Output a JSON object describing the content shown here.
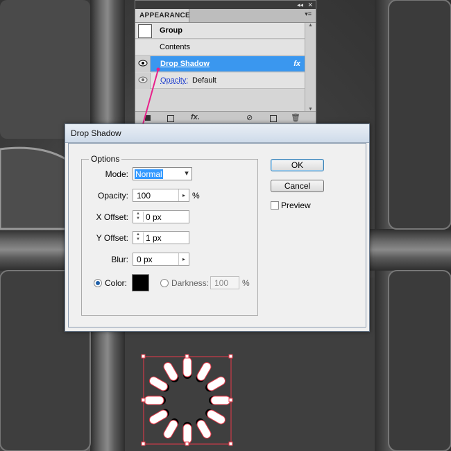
{
  "appearance_panel": {
    "tab_label": "APPEARANCE",
    "collapse_glyph": "◂◂",
    "close_glyph": "✕",
    "menu_glyph": "▾≡",
    "rows": [
      {
        "label": "Group"
      },
      {
        "label": "Contents"
      },
      {
        "label": "Drop Shadow",
        "fx": "fx"
      },
      {
        "label": "Opacity:",
        "value": "Default"
      }
    ],
    "scroll_up": "▲",
    "scroll_down": "▼",
    "bottom_fx": "fx."
  },
  "dialog": {
    "title": "Drop Shadow",
    "options_legend": "Options",
    "mode": {
      "label": "Mode:",
      "value": "Normal",
      "arrow": "▾"
    },
    "opacity": {
      "label": "Opacity:",
      "value": "100",
      "unit": "%",
      "arrow": "▸"
    },
    "x_offset": {
      "label": "X Offset:",
      "value": "0 px"
    },
    "y_offset": {
      "label": "Y Offset:",
      "value": "1 px"
    },
    "blur": {
      "label": "Blur:",
      "value": "0 px",
      "arrow": "▸"
    },
    "color": {
      "label": "Color:",
      "selected": true,
      "swatch": "#000000"
    },
    "darkness": {
      "label": "Darkness:",
      "value": "100",
      "unit": "%"
    },
    "ok_label": "OK",
    "cancel_label": "Cancel",
    "preview_label": "Preview",
    "preview_checked": false
  },
  "colors": {
    "selection_blue": "#3a97ef",
    "arrow_magenta": "#e8208a",
    "selection_red": "#e83a4a"
  }
}
